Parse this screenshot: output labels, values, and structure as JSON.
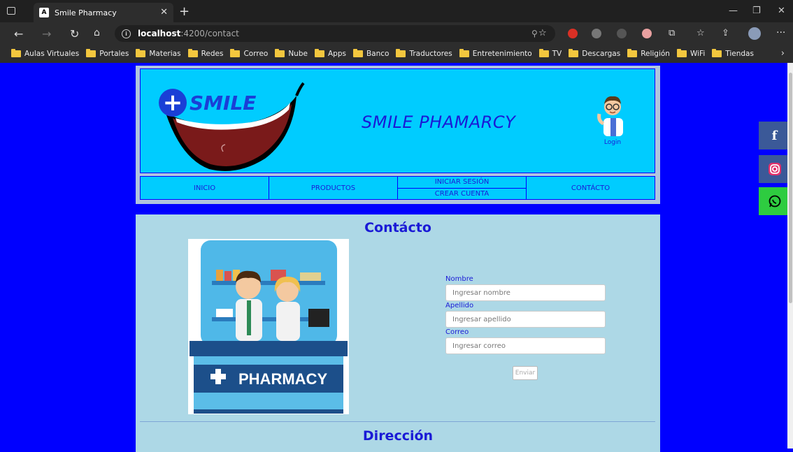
{
  "browser": {
    "tab_title": "Smile Pharmacy",
    "tab_favicon": "A",
    "url_host": "localhost",
    "url_path": ":4200/contact",
    "bookmarks": [
      "Aulas Virtuales",
      "Portales",
      "Materias",
      "Redes",
      "Correo",
      "Nube",
      "Apps",
      "Banco",
      "Traductores",
      "Entretenimiento",
      "TV",
      "Descargas",
      "Religión",
      "WiFi",
      "Tiendas"
    ]
  },
  "header": {
    "logo_text": "SMILE",
    "site_title": "SMILE PHAMARCY",
    "login_label": "Login"
  },
  "nav": {
    "inicio": "INICIO",
    "productos": "PRODUCTOS",
    "iniciar_sesion": "INICIAR SESIÓN",
    "crear_cuenta": "CREAR CUENTA",
    "contacto": "CONTÁCTO"
  },
  "contact": {
    "title": "Contácto",
    "image_text": "PHARMACY",
    "nombre_label": "Nombre",
    "nombre_placeholder": "Ingresar nombre",
    "apellido_label": "Apellido",
    "apellido_placeholder": "Ingresar apellido",
    "correo_label": "Correo",
    "correo_placeholder": "Ingresar correo",
    "send_label": "Enviar"
  },
  "direccion": {
    "title": "Dirección"
  },
  "social": [
    "facebook-icon",
    "instagram-icon",
    "whatsapp-icon"
  ],
  "colors": {
    "page_bg": "#0000ff",
    "banner_bg": "#00ccff",
    "content_bg": "#add8e6",
    "accent_text": "#1a1ad6"
  }
}
